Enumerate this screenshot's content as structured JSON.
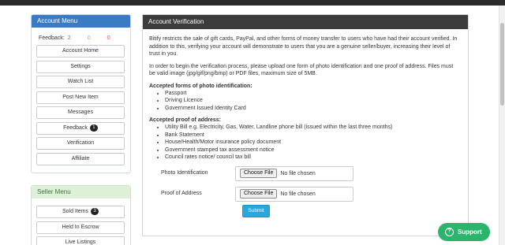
{
  "account_menu": {
    "title": "Account Menu",
    "feedback_label": "Feedback:",
    "feedback_positive": "2",
    "feedback_neutral": "0",
    "feedback_negative": "0",
    "items": [
      {
        "label": "Account Home"
      },
      {
        "label": "Settings"
      },
      {
        "label": "Watch List"
      },
      {
        "label": "Post New Item"
      },
      {
        "label": "Messages"
      },
      {
        "label": "Feedback",
        "badge": "1"
      },
      {
        "label": "Verification"
      },
      {
        "label": "Affiliate"
      }
    ]
  },
  "seller_menu": {
    "title": "Seller Menu",
    "items": [
      {
        "label": "Sold Items",
        "badge": "3"
      },
      {
        "label": "Held In Escrow"
      },
      {
        "label": "Live Listings"
      }
    ]
  },
  "verification": {
    "title": "Account Verification",
    "intro": "Bitify restricts the sale of gift cards, PayPal, and other forms of money transfer to users who have had their account verified. In addition to this, verifying your account will demonstrate to users that you are a genuine seller/buyer, increasing their level of trust in you.",
    "instructions": "In order to begin the verification process, please upload one form of photo identification and one proof of address. Files must be valid image (jpg/gif/png/bmp) or PDF files, maximum size of 5MB.",
    "photo_id_heading": "Accepted forms of photo identification:",
    "photo_id_items": [
      "Passport",
      "Driving Licence",
      "Government Issued Identity Card"
    ],
    "address_heading": "Accepted proof of address:",
    "address_items": [
      "Utility Bill e.g. Electricity, Gas, Water, Landline phone bill (issued within the last three months)",
      "Bank Statement",
      "House/Health/Motor insurance policy document",
      "Government stamped tax assessment notice",
      "Council rates notice/ council tax bill"
    ],
    "photo_field_label": "Photo Identification",
    "address_field_label": "Proof of Address",
    "choose_file_label": "Choose File",
    "no_file_text": "No file chosen",
    "submit_label": "Submit"
  },
  "support": {
    "label": "Support",
    "icon": "question-circle-icon"
  },
  "colors": {
    "account_header": "#3a7cc3",
    "seller_header": "#dff0d8",
    "main_header": "#3c3c3c",
    "submit": "#2aa7dd",
    "support": "#2bb56c"
  }
}
